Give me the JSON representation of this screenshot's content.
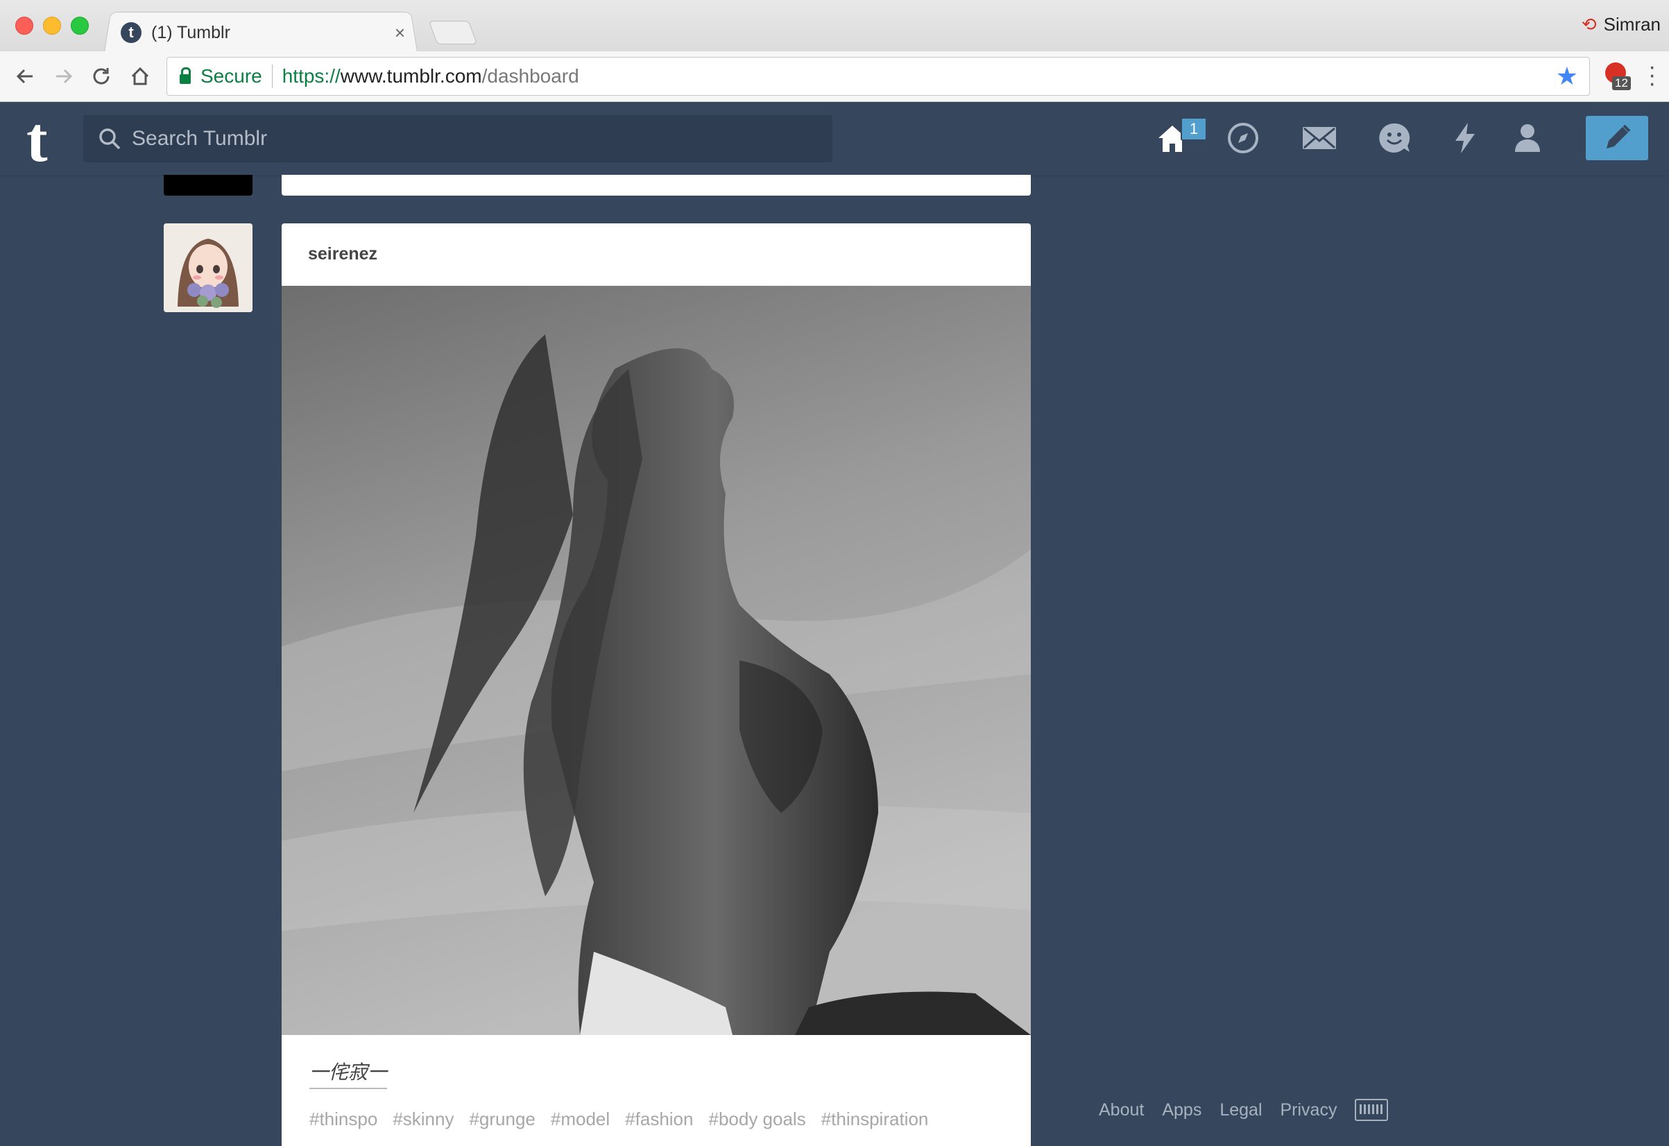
{
  "browser": {
    "tab_title": "(1) Tumblr",
    "tab_favicon": "t",
    "tab_close": "×",
    "profile_name": "Simran",
    "secure_label": "Secure",
    "url_scheme": "https://",
    "url_host": "www.tumblr.com",
    "url_path": "/dashboard",
    "extension_badge": "12",
    "icons": {
      "back": "arrow-left-icon",
      "forward": "arrow-right-icon",
      "reload": "reload-icon",
      "home": "home-icon",
      "bookmark": "star-icon",
      "menu": "vertical-dots-icon"
    }
  },
  "tumblr": {
    "logo": "t",
    "search_placeholder": "Search Tumblr",
    "home_badge": "1",
    "nav_icons": [
      "home-icon",
      "compass-icon",
      "mail-icon",
      "smiley-icon",
      "lightning-icon",
      "person-icon",
      "pencil-icon"
    ],
    "accent": "#529ecc",
    "background": "#36465d"
  },
  "post": {
    "author": "seirenez",
    "caption": "一侘寂一",
    "tags": [
      "#thinspo",
      "#skinny",
      "#grunge",
      "#model",
      "#fashion",
      "#body goals",
      "#thinspiration"
    ]
  },
  "footer": {
    "links": [
      "About",
      "Apps",
      "Legal",
      "Privacy"
    ]
  }
}
